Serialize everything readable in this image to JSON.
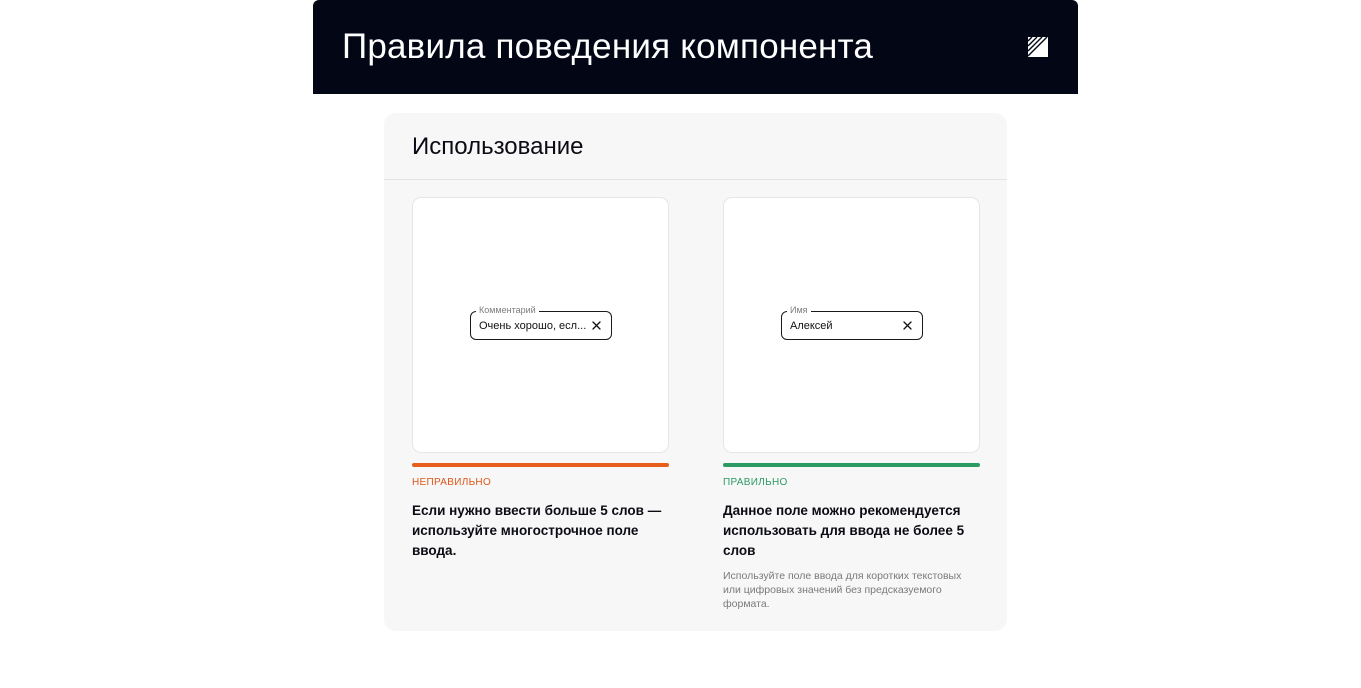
{
  "header": {
    "title": "Правила поведения компонента",
    "logo_icon": "brand-logo-icon"
  },
  "panel": {
    "title": "Использование"
  },
  "examples": [
    {
      "verdict": "НЕПРАВИЛЬНО",
      "accent": "#e85d1a",
      "field": {
        "label": "Комментарий",
        "value": "Очень хорошо, есл...",
        "icon": "close-icon"
      },
      "description": "Если нужно ввести больше 5 слов — используйте многострочное поле ввода.",
      "note": ""
    },
    {
      "verdict": "ПРАВИЛЬНО",
      "accent": "#2c9a63",
      "field": {
        "label": "Имя",
        "value": "Алексей",
        "icon": "close-icon"
      },
      "description": "Данное поле можно рекомендуется использовать для ввода не более 5 слов",
      "note": "Используйте поле ввода для коротких текстовых или цифровых значений без предсказуемого формата."
    }
  ]
}
